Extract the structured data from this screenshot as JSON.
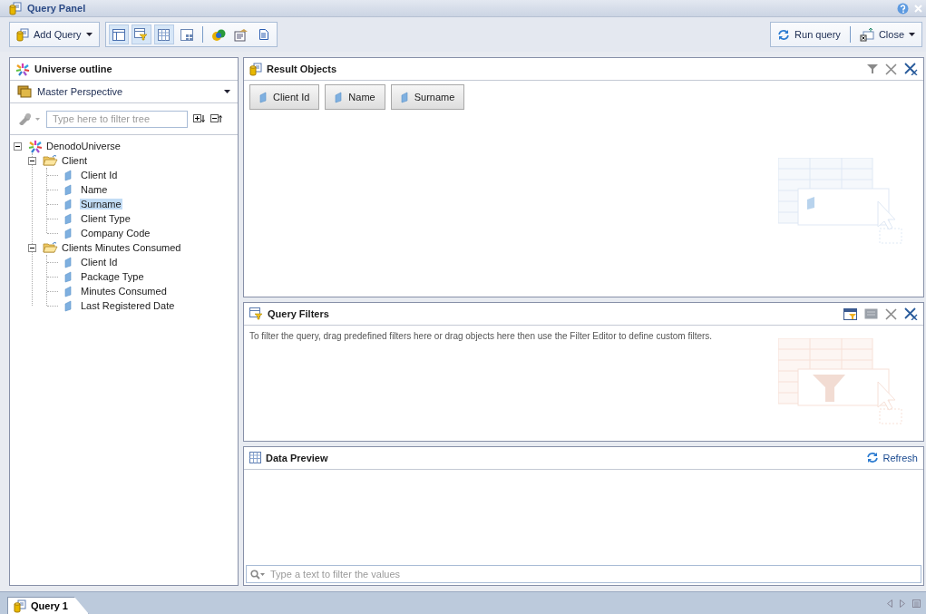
{
  "window": {
    "title": "Query Panel"
  },
  "toolbar": {
    "add_query": "Add Query",
    "view_buttons": [
      {
        "kind": "outline",
        "selected": true
      },
      {
        "kind": "filters",
        "selected": true
      },
      {
        "kind": "preview",
        "selected": true
      },
      {
        "kind": "layout",
        "selected": false
      }
    ],
    "run_query": "Run query",
    "close": "Close"
  },
  "outline": {
    "title": "Universe outline",
    "perspective": "Master Perspective",
    "filter_placeholder": "Type here to filter tree",
    "tree": [
      {
        "label": "DenodoUniverse",
        "kind": "universe",
        "expanded": true,
        "selected": false,
        "children": [
          {
            "label": "Client",
            "kind": "folder",
            "expanded": true,
            "selected": false,
            "children": [
              {
                "label": "Client Id",
                "kind": "dimension",
                "selected": false
              },
              {
                "label": "Name",
                "kind": "dimension",
                "selected": false
              },
              {
                "label": "Surname",
                "kind": "dimension",
                "selected": true
              },
              {
                "label": "Client Type",
                "kind": "dimension",
                "selected": false
              },
              {
                "label": "Company Code",
                "kind": "dimension",
                "selected": false
              }
            ]
          },
          {
            "label": "Clients Minutes Consumed",
            "kind": "folder",
            "expanded": true,
            "selected": false,
            "children": [
              {
                "label": "Client Id",
                "kind": "dimension",
                "selected": false
              },
              {
                "label": "Package Type",
                "kind": "dimension",
                "selected": false
              },
              {
                "label": "Minutes Consumed",
                "kind": "dimension",
                "selected": false
              },
              {
                "label": "Last Registered Date",
                "kind": "dimension",
                "selected": false
              }
            ]
          }
        ]
      }
    ]
  },
  "result_objects": {
    "title": "Result Objects",
    "objects": [
      "Client Id",
      "Name",
      "Surname"
    ]
  },
  "query_filters": {
    "title": "Query Filters",
    "hint": "To filter the query, drag predefined filters here or drag objects here then use the Filter Editor to define custom filters."
  },
  "data_preview": {
    "title": "Data Preview",
    "refresh": "Refresh",
    "filter_placeholder": "Type a text to filter the values"
  },
  "tabs": [
    {
      "label": "Query 1",
      "selected": true
    }
  ]
}
